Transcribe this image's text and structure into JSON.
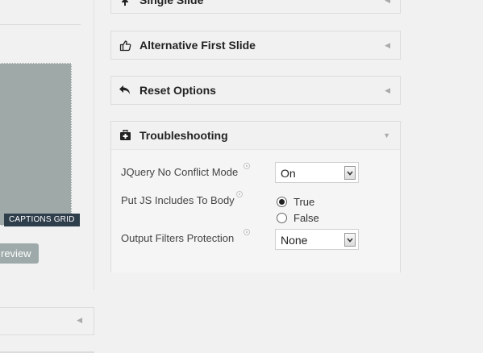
{
  "left": {
    "captions_grid_label": "CAPTIONS GRID",
    "preview_button_label": "review"
  },
  "panels": {
    "single_slide": {
      "title": "Single Slide"
    },
    "alternative_first_slide": {
      "title": "Alternative First Slide"
    },
    "reset_options": {
      "title": "Reset Options"
    },
    "troubleshooting": {
      "title": "Troubleshooting",
      "jquery_no_conflict": {
        "label": "JQuery No Conflict Mode",
        "value": "On"
      },
      "put_js_includes": {
        "label": "Put JS Includes To Body",
        "options": [
          "True",
          "False"
        ],
        "selected": "True"
      },
      "output_filters": {
        "label": "Output Filters Protection",
        "value": "None"
      }
    }
  },
  "icons": {
    "single_slide": "pin-icon",
    "alternative_first_slide": "thumbs-up-icon",
    "reset_options": "undo-icon",
    "troubleshooting": "first-aid-kit-icon",
    "collapse": "arrow-left-icon",
    "expand": "arrow-down-icon"
  }
}
